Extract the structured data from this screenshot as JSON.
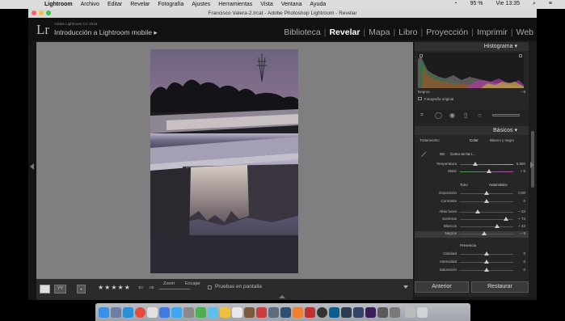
{
  "menubar": {
    "items": [
      "Lightroom",
      "Archivo",
      "Editar",
      "Revelar",
      "Fotografía",
      "Ajustes",
      "Herramientas",
      "Vista",
      "Ventana",
      "Ayuda"
    ],
    "battery": "95 %",
    "clock": "Vie 13:35"
  },
  "window": {
    "title": "Francisco Valera-2.lrcat - Adobe Photoshop Lightroom - Revelar"
  },
  "header": {
    "logo": "Lr",
    "catalog_label": "Adobe Lightroom CC 2015",
    "catalog_name": "Introducción a Lightroom mobile ▸",
    "modules": [
      "Biblioteca",
      "Revelar",
      "Mapa",
      "Libro",
      "Proyección",
      "Imprimir",
      "Web"
    ],
    "active_module": "Revelar"
  },
  "toolbar": {
    "zoom_label": "Zoom",
    "fit_label": "Encajar",
    "rating": "★★★★★",
    "softproof_label": "Pruebas en pantalla"
  },
  "histogram": {
    "title": "Histograma",
    "readout": "Negros",
    "readout_value": "– 8",
    "original_label": "Fotografía original"
  },
  "basics": {
    "title": "Básicos",
    "treatment_label": "Tratamiento:",
    "color_label": "Color",
    "bw_label": "Blanco y negro",
    "wb_label": "BB:",
    "wb_value": "Como se ha t…",
    "temp_label": "Temperatura",
    "temp_value": "5.850",
    "tint_label": "Matiz",
    "tint_value": "+ 5",
    "tone_label": "Tono",
    "auto_label": "Automático",
    "tone_sliders": [
      {
        "label": "Exposición",
        "value": "0,00",
        "level": 0.5
      },
      {
        "label": "Contraste",
        "value": "0",
        "level": 0.5
      },
      {
        "label": "Altas luces",
        "value": "– 33",
        "level": 0.34
      },
      {
        "label": "Sombras",
        "value": "+ 73",
        "level": 0.86
      },
      {
        "label": "Blancos",
        "value": "+ 43",
        "level": 0.7
      },
      {
        "label": "Negros",
        "value": "– 8",
        "level": 0.46
      }
    ],
    "presence_label": "Presencia",
    "presence_sliders": [
      {
        "label": "Claridad",
        "value": "0",
        "level": 0.5
      },
      {
        "label": "Intensidad",
        "value": "0",
        "level": 0.5
      },
      {
        "label": "Saturación",
        "value": "0",
        "level": 0.5
      }
    ]
  },
  "buttons": {
    "previous": "Anterior",
    "reset": "Restaurar"
  },
  "colors": {
    "accent": "#ffffff",
    "panel": "#262626",
    "canvas": "#7f7f7f"
  }
}
